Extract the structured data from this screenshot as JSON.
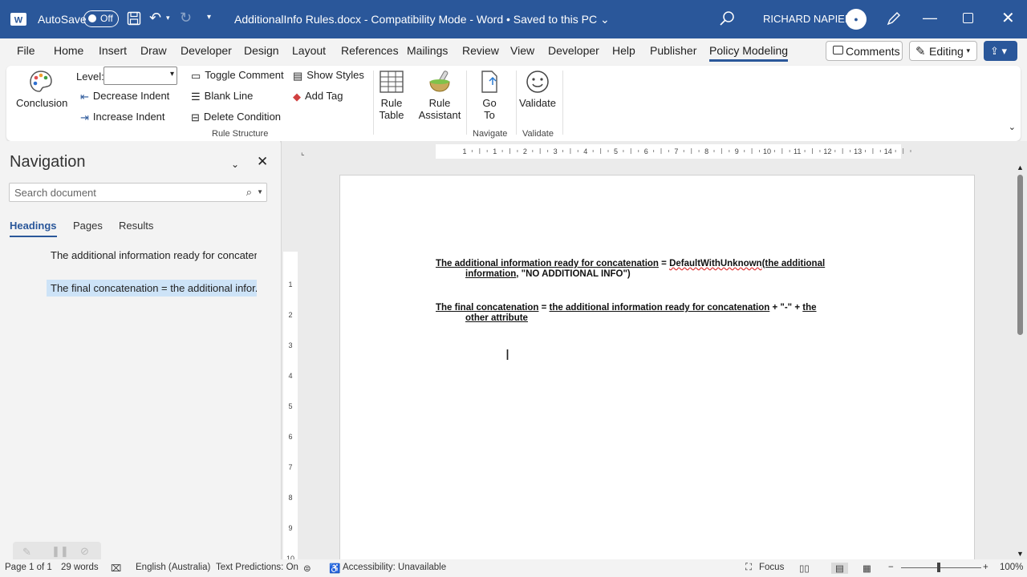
{
  "titlebar": {
    "autosave_label": "AutoSave",
    "autosave_state": "Off",
    "document_title": "AdditionalInfo Rules.docx  -  Compatibility Mode  -  Word  •  Saved to this PC ⌄",
    "user_name": "RICHARD NAPIER",
    "accent": "#2a579a"
  },
  "menu": {
    "tabs": [
      "File",
      "Home",
      "Insert",
      "Draw",
      "Developer",
      "Design",
      "Layout",
      "References",
      "Mailings",
      "Review",
      "View",
      "Developer",
      "Help",
      "Publisher",
      "Policy Modeling"
    ],
    "comments_label": "Comments",
    "editing_label": "Editing"
  },
  "ribbon": {
    "conclusion": "Conclusion",
    "level_label": "Level:",
    "decrease_indent": "Decrease Indent",
    "increase_indent": "Increase Indent",
    "toggle_comment": "Toggle Comment",
    "blank_line": "Blank Line",
    "delete_condition": "Delete Condition",
    "show_styles": "Show Styles",
    "add_tag": "Add Tag",
    "rule_table_1": "Rule",
    "rule_table_2": "Table",
    "rule_assistant_1": "Rule",
    "rule_assistant_2": "Assistant",
    "goto_1": "Go",
    "goto_2": "To",
    "validate": "Validate",
    "group_rule_structure": "Rule Structure",
    "group_navigate": "Navigate",
    "group_validate": "Validate"
  },
  "nav": {
    "title": "Navigation",
    "search_placeholder": "Search document",
    "tabs": [
      "Headings",
      "Pages",
      "Results"
    ],
    "headings": [
      "The additional information ready for concaten...",
      "The final concatenation = the additional infor..."
    ]
  },
  "document": {
    "rule1": {
      "lhs": "The additional information ready for concatenation",
      "eq": " = ",
      "fn": "DefaultWithUnknown",
      "rest": "(the additional",
      "line2a": "information",
      "line2b": ", \"NO ADDITIONAL INFO\")"
    },
    "rule2": {
      "lhs": "The final concatenation",
      "eq": " = ",
      "mid": "the additional information ready for concatenation",
      "plus": " + \"-\" + ",
      "the": "the",
      "line2": "other attribute"
    }
  },
  "status": {
    "page": "Page 1 of 1",
    "words": "29 words",
    "language": "English (Australia)",
    "predictions": "Text Predictions: On",
    "accessibility": "Accessibility: Unavailable",
    "focus": "Focus",
    "zoom": "100%"
  }
}
